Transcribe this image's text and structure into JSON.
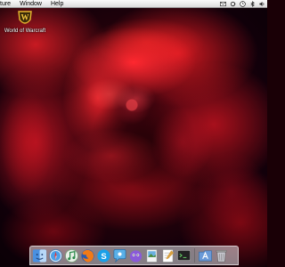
{
  "menubar": {
    "items": [
      "ture",
      "Window",
      "Help"
    ],
    "status_icons": [
      "mail-icon",
      "sync-icon",
      "clock-icon",
      "bluetooth-icon",
      "volume-icon"
    ]
  },
  "desktop": {
    "wallpaper": "red rose",
    "icons": [
      {
        "label": "World of Warcraft",
        "icon": "world-of-warcraft-icon"
      }
    ]
  },
  "dock": {
    "apps": [
      "finder-icon",
      "safari-icon",
      "itunes-icon",
      "firefox-icon",
      "skype-icon",
      "ichat-icon",
      "adium-icon",
      "preview-icon",
      "textedit-icon",
      "terminal-icon"
    ],
    "right": [
      "applications-folder-icon",
      "trash-icon"
    ]
  },
  "colors": {
    "rose_red": "#c81a22",
    "rose_dark": "#26020a",
    "menubar": "#f0f0f0"
  }
}
